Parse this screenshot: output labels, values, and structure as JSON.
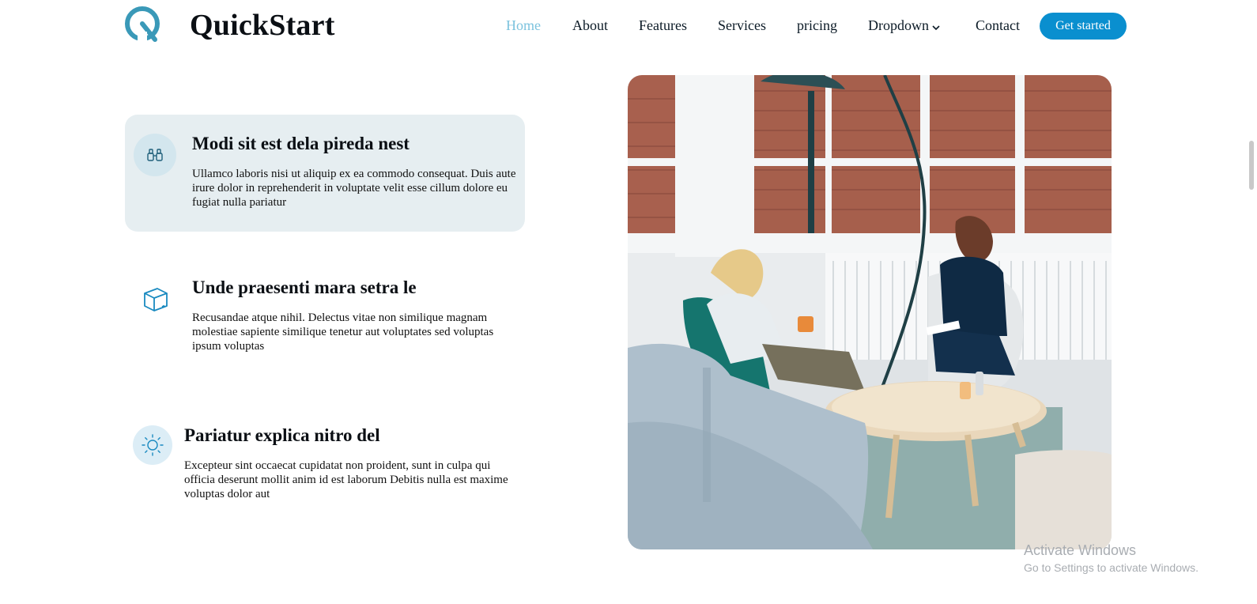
{
  "brand": {
    "name": "QuickStart",
    "accent": "#0a8fcf",
    "logo_color": "#3a99b8"
  },
  "nav": {
    "items": [
      {
        "label": "Home",
        "active": true
      },
      {
        "label": "About"
      },
      {
        "label": "Features"
      },
      {
        "label": "Services"
      },
      {
        "label": "pricing"
      },
      {
        "label": "Dropdown",
        "icon": "chevron-down-icon"
      },
      {
        "label": "Contact"
      }
    ],
    "cta": "Get started"
  },
  "features": [
    {
      "icon": "binoculars-icon",
      "title": "Modi sit est dela pireda nest",
      "desc": "Ullamco laboris nisi ut aliquip ex ea commodo consequat. Duis aute irure dolor in reprehenderit in voluptate velit esse cillum dolore eu fugiat nulla pariatur",
      "active": true
    },
    {
      "icon": "box-icon",
      "title": "Unde praesenti mara setra le",
      "desc": "Recusandae atque nihil. Delectus vitae non similique magnam molestiae sapiente similique tenetur aut voluptates sed voluptas ipsum voluptas"
    },
    {
      "icon": "sun-icon",
      "title": "Pariatur explica nitro del",
      "desc": "Excepteur sint occaecat cupidatat non proident, sunt in culpa qui officia deserunt mollit anim id est laborum Debitis nulla est maxime voluptas dolor aut"
    }
  ],
  "watermark": {
    "line1": "Activate Windows",
    "line2": "Go to Settings to activate Windows."
  }
}
